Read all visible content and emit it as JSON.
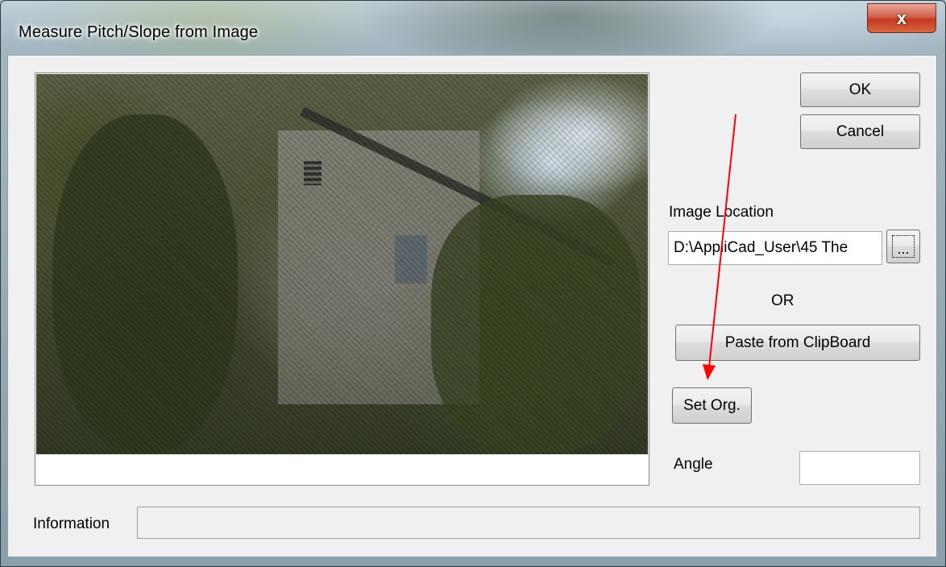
{
  "window": {
    "title": "Measure Pitch/Slope from Image",
    "close_glyph": "x"
  },
  "buttons": {
    "ok": "OK",
    "cancel": "Cancel",
    "browse": "...",
    "paste": "Paste from ClipBoard",
    "set_origin": "Set Org."
  },
  "image_location": {
    "label": "Image Location",
    "value": "D:\\AppliCad_User\\45 The"
  },
  "or_label": "OR",
  "angle": {
    "label": "Angle",
    "value": ""
  },
  "information": {
    "label": "Information",
    "value": ""
  },
  "icons": {
    "close": "close-icon",
    "browse": "ellipsis-icon"
  },
  "colors": {
    "annotation_arrow": "#ff0000",
    "close_button": "#c2391f",
    "dialog_background": "#f0f0f0"
  }
}
